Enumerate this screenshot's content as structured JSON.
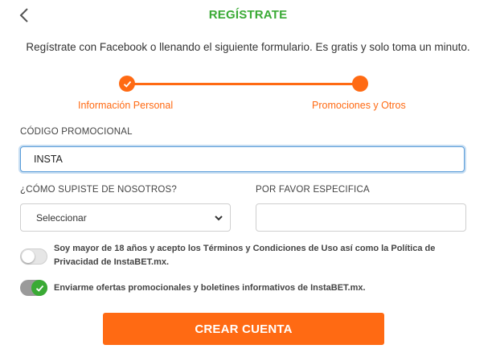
{
  "header": {
    "title": "REGÍSTRATE",
    "back_icon": "chevron-left-icon"
  },
  "intro": {
    "text": "Regístrate con Facebook o llenando el siguiente formulario. Es gratis y solo toma un minuto."
  },
  "stepper": {
    "steps": [
      {
        "label": "Información Personal",
        "state": "completed",
        "icon": "check-icon"
      },
      {
        "label": "Promociones y Otros",
        "state": "current"
      }
    ]
  },
  "form": {
    "promo_code": {
      "label": "CÓDIGO PROMOCIONAL",
      "value": "INSTA"
    },
    "how_heard": {
      "label": "¿CÓMO SUPISTE DE NOSOTROS?",
      "selected": "Seleccionar",
      "icon": "chevron-down-icon"
    },
    "specify": {
      "label": "POR FAVOR ESPECIFICA",
      "value": ""
    },
    "terms_toggle": {
      "checked": false,
      "text": "Soy mayor de 18 años y acepto los Términos y Condiciones de Uso así como la Política de Privacidad de InstaBET.mx."
    },
    "offers_toggle": {
      "checked": true,
      "text": "Enviarme ofertas promocionales y boletines informativos de InstaBET.mx."
    },
    "submit_label": "CREAR CUENTA"
  },
  "colors": {
    "brand_green": "#3aaa35",
    "accent_orange": "#ff6a13",
    "focus_blue": "#5b9dd9"
  }
}
